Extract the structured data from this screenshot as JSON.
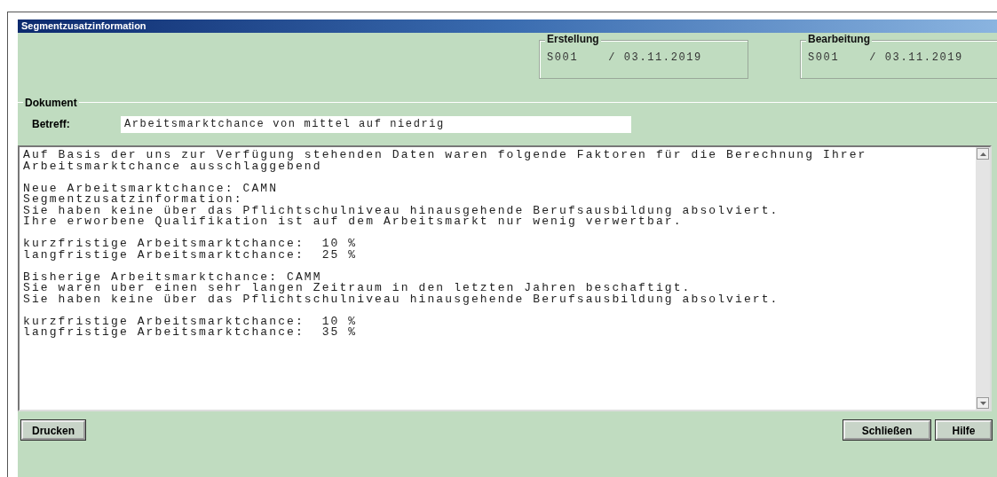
{
  "window": {
    "title": "Segmentzusatzinformation"
  },
  "groups": [
    {
      "label": "Erstellung",
      "user": "S001",
      "date": "/ 03.11.2019"
    },
    {
      "label": "Bearbeitung",
      "user": "S001",
      "date": "/ 03.11.2019"
    }
  ],
  "document": {
    "label": "Dokument",
    "subject_label": "Betreff:",
    "subject": "Arbeitsmarktchance von mittel auf niedrig",
    "paragraphs": [
      [
        "Auf Basis der uns zur Verfügung stehenden Daten waren folgende Faktoren für die Berechnung Ihrer",
        "Arbeitsmarktchance ausschlaggebend"
      ],
      [
        "Neue Arbeitsmarktchance: CAMN",
        "Segmentzusatzinformation:",
        "Sie haben keine über das Pflichtschulniveau hinausgehende Berufsausbildung absolviert.",
        "Ihre erworbene Qualifikation ist auf dem Arbeitsmarkt nur wenig verwertbar."
      ],
      [
        "kurzfristige Arbeitsmarktchance:  10 %",
        "langfristige Arbeitsmarktchance:  25 %"
      ],
      [
        "Bisherige Arbeitsmarktchance: CAMM",
        "Sie waren uber einen sehr langen Zeitraum in den letzten Jahren beschaftigt.",
        "Sie haben keine über das Pflichtschulniveau hinausgehende Berufsausbildung absolviert."
      ],
      [
        "kurzfristige Arbeitsmarktchance:  10 %",
        "langfristige Arbeitsmarktchance:  35 %"
      ]
    ]
  },
  "left_buttons": [
    "Drucken"
  ],
  "right_buttons": [
    "Schließen",
    "Hilfe"
  ]
}
